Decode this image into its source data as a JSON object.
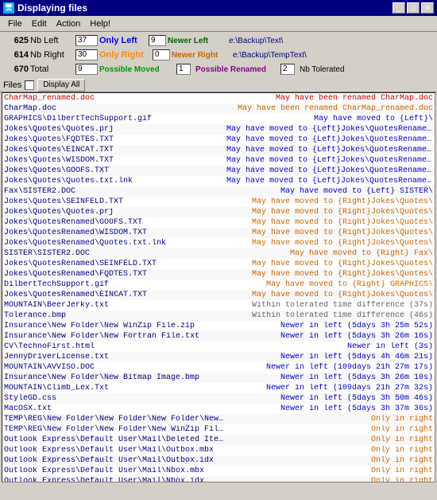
{
  "titleBar": {
    "title": "Displaying files",
    "minBtn": "_",
    "maxBtn": "□",
    "closeBtn": "✕"
  },
  "menu": {
    "items": [
      "File",
      "Edit",
      "Action",
      "Help!"
    ]
  },
  "stats": {
    "row1": {
      "num": "625",
      "nbLeft": "Nb Left",
      "val": "37",
      "onlyLeft": "Only Left",
      "onlyLeftVal": "9",
      "newerLeft": "Newer Left",
      "newerLeftPath": "e:\\Backup\\Text\\"
    },
    "row2": {
      "num": "614",
      "nbRight": "Nb Right",
      "val": "30",
      "onlyRight": "Only Right",
      "onlyRightVal": "0",
      "newerRight": "Newer Right",
      "newerRightPath": "e:\\Backup\\TempText\\"
    },
    "row3": {
      "num": "670",
      "total": "Total",
      "val": "9",
      "possibleMoved": "Possible Moved",
      "possibleMovedVal": "1",
      "possibleRenamed": "Possible Renamed",
      "possibleRenamedVal": "2",
      "nbTolerated": "Nb Tolerated"
    }
  },
  "filesBar": {
    "label": "Files",
    "displayAll": "Display All"
  },
  "fileList": [
    {
      "name": "CharMap_renamed.doc",
      "status": "May have been renamed CharMap.doc",
      "statusColor": "red",
      "nameColor": "red"
    },
    {
      "name": "CharMap.doc",
      "status": "May have been renamed CharMap_renamed.doc",
      "statusColor": "orange",
      "nameColor": "blue"
    },
    {
      "name": "GRAPHICS\\DilbertTechSupport.gif",
      "status": "May have moved to {Left}\\",
      "statusColor": "blue",
      "nameColor": "blue"
    },
    {
      "name": "Jokes\\Quotes\\Quotes.prj",
      "status": "May have moved to {Left}Jokes\\QuotesRenamed\\",
      "statusColor": "blue",
      "nameColor": "blue"
    },
    {
      "name": "Jokes\\Quotes\\FQDTES.TXT",
      "status": "May have moved to {Left}Jokes\\QuotesRenamed\\",
      "statusColor": "blue",
      "nameColor": "blue"
    },
    {
      "name": "Jokes\\Quotes\\EINCAT.TXT",
      "status": "May have moved to {Left}Jokes\\QuotesRenamed\\",
      "statusColor": "blue",
      "nameColor": "blue"
    },
    {
      "name": "Jokes\\Quotes\\WISDOM.TXT",
      "status": "May have moved to {Left}Jokes\\QuotesRenamed\\",
      "statusColor": "blue",
      "nameColor": "blue"
    },
    {
      "name": "Jokes\\Quotes\\GOOFS.TXT",
      "status": "May have moved to {Left}Jokes\\QuotesRenamed\\",
      "statusColor": "blue",
      "nameColor": "blue"
    },
    {
      "name": "Jokes\\Quotes\\Quotes.txt.lnk",
      "status": "May have moved to {Left}Jokes\\QuotesRenamed\\",
      "statusColor": "blue",
      "nameColor": "blue"
    },
    {
      "name": "Fax\\SISTER2.DOC",
      "status": "May have moved to {Left} SISTER\\",
      "statusColor": "blue",
      "nameColor": "blue"
    },
    {
      "name": "Jokes\\Quotes\\SEINFELD.TXT",
      "status": "May have moved to {Right}Jokes\\Quotes\\",
      "statusColor": "orange",
      "nameColor": "blue"
    },
    {
      "name": "Jokes\\Quotes\\Quotes.prj",
      "status": "May have moved to {Right}Jokes\\Quotes\\",
      "statusColor": "orange",
      "nameColor": "blue"
    },
    {
      "name": "Jokes\\QuotesRenamed\\GOOFS.TXT",
      "status": "May have moved to {Right}Jokes\\Quotes\\",
      "statusColor": "orange",
      "nameColor": "blue"
    },
    {
      "name": "Jokes\\QuotesRenamed\\WISDOM.TXT",
      "status": "May have moved to {Right}Jokes\\Quotes\\",
      "statusColor": "orange",
      "nameColor": "blue"
    },
    {
      "name": "Jokes\\QuotesRenamed\\Quotes.txt.lnk",
      "status": "May have moved to {Right}Jokes\\Quotes\\",
      "statusColor": "orange",
      "nameColor": "blue"
    },
    {
      "name": "SISTER\\SISTER2.DOC",
      "status": "May have moved to {Right} Fax\\",
      "statusColor": "orange",
      "nameColor": "blue"
    },
    {
      "name": "Jokes\\QuotesRenamed\\SEINFELD.TXT",
      "status": "May have moved to {Right}Jokes\\Quotes\\",
      "statusColor": "orange",
      "nameColor": "blue"
    },
    {
      "name": "Jokes\\QuotesRenamed\\FQDTES.TXT",
      "status": "May have moved to {Right}Jokes\\Quotes\\",
      "statusColor": "orange",
      "nameColor": "blue"
    },
    {
      "name": "DilbertTechSupport.gif",
      "status": "May have moved to {Right} GRAPHICS\\",
      "statusColor": "orange",
      "nameColor": "blue"
    },
    {
      "name": "Jokes\\QuotesRenamed\\EINCAT.TXT",
      "status": "May have moved to {Right}Jokes\\Quotes\\",
      "statusColor": "orange",
      "nameColor": "blue"
    },
    {
      "name": "MOUNTAIN\\BeerJerky.txt",
      "status": "Within tolerated time difference (37s)",
      "statusColor": "gray",
      "nameColor": "blue"
    },
    {
      "name": "Tolerance.bmp",
      "status": "Within tolerated time difference (46s)",
      "statusColor": "gray",
      "nameColor": "blue"
    },
    {
      "name": "Insurance\\New Folder\\New WinZip File.zip",
      "status": "Newer in left (5days 3h 25m 52s)",
      "statusColor": "blue",
      "nameColor": "blue"
    },
    {
      "name": "Insurance\\New Folder\\New Fortran File.txt",
      "status": "Newer in left (5days 3h 26m 16s)",
      "statusColor": "blue",
      "nameColor": "blue"
    },
    {
      "name": "CV\\TechnoFirst.html",
      "status": "Newer in left (3s)",
      "statusColor": "blue",
      "nameColor": "blue"
    },
    {
      "name": "JennyDriverLicense.txt",
      "status": "Newer in left (5days 4h 46m 21s)",
      "statusColor": "blue",
      "nameColor": "blue"
    },
    {
      "name": "MOUNTAIN\\AVVISO.DOC",
      "status": "Newer in left (109days 21h 27m 17s)",
      "statusColor": "blue",
      "nameColor": "blue"
    },
    {
      "name": "Insurance\\New Folder\\New Bitmap Image.bmp",
      "status": "Newer in left (5days 3h 26m 10s)",
      "statusColor": "blue",
      "nameColor": "blue"
    },
    {
      "name": "MOUNTAIN\\Climb_Lex.Txt",
      "status": "Newer in left (109days 21h 27m 32s)",
      "statusColor": "blue",
      "nameColor": "blue"
    },
    {
      "name": "StyleGD.css",
      "status": "Newer in left (5days 3h 50m 46s)",
      "statusColor": "blue",
      "nameColor": "blue"
    },
    {
      "name": "MacOSX.txt",
      "status": "Newer in left (5days 3h 37m 36s)",
      "statusColor": "blue",
      "nameColor": "blue"
    },
    {
      "name": "TEMP\\REG\\New Folder\\New Folder\\New Folder\\New Bitmap Image.bmp",
      "status": "Only in right",
      "statusColor": "orange",
      "nameColor": "blue"
    },
    {
      "name": "TEMP\\REG\\New Folder\\New Folder\\New WinZip File.zip",
      "status": "Only in right",
      "statusColor": "orange",
      "nameColor": "blue"
    },
    {
      "name": "Outlook Express\\Default User\\Mail\\Deleted Items.mbx",
      "status": "Only in right",
      "statusColor": "orange",
      "nameColor": "blue"
    },
    {
      "name": "Outlook Express\\Default User\\Mail\\Outbox.mbx",
      "status": "Only in right",
      "statusColor": "orange",
      "nameColor": "blue"
    },
    {
      "name": "Outlook Express\\Default User\\Mail\\Outbox.idx",
      "status": "Only in right",
      "statusColor": "orange",
      "nameColor": "blue"
    },
    {
      "name": "Outlook Express\\Default User\\Mail\\Nbox.mbx",
      "status": "Only in right",
      "statusColor": "orange",
      "nameColor": "blue"
    },
    {
      "name": "Outlook Express\\Default User\\Mail\\Nbox.idx",
      "status": "Only in right",
      "statusColor": "orange",
      "nameColor": "blue"
    }
  ]
}
